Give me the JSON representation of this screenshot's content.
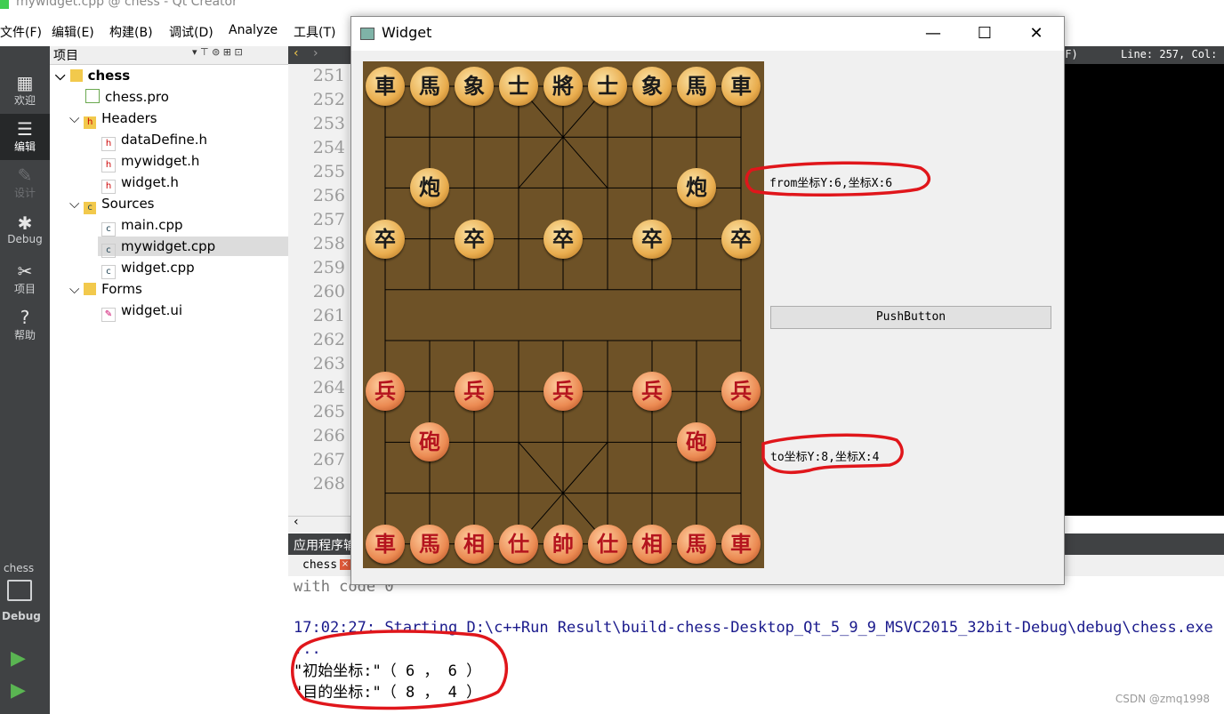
{
  "app": {
    "title": "mywidget.cpp @ chess - Qt Creator"
  },
  "menu": [
    "文件(F)",
    "编辑(E)",
    "构建(B)",
    "调试(D)",
    "Analyze",
    "工具(T)"
  ],
  "modes": [
    {
      "label": "欢迎",
      "icon": "grid-icon"
    },
    {
      "label": "编辑",
      "icon": "edit-icon"
    },
    {
      "label": "设计",
      "icon": "pencil-icon"
    },
    {
      "label": "Debug",
      "icon": "bug-icon"
    },
    {
      "label": "项目",
      "icon": "wrench-icon"
    },
    {
      "label": "帮助",
      "icon": "help-icon"
    }
  ],
  "kit": {
    "project": "chess",
    "mode": "Debug"
  },
  "project_panel": {
    "header": "项目",
    "tree": [
      {
        "label": "chess",
        "depth": 0
      },
      {
        "label": "chess.pro",
        "depth": 1
      },
      {
        "label": "Headers",
        "depth": 1
      },
      {
        "label": "dataDefine.h",
        "depth": 2
      },
      {
        "label": "mywidget.h",
        "depth": 2
      },
      {
        "label": "widget.h",
        "depth": 2
      },
      {
        "label": "Sources",
        "depth": 1
      },
      {
        "label": "main.cpp",
        "depth": 2
      },
      {
        "label": "mywidget.cpp",
        "depth": 2,
        "selected": true
      },
      {
        "label": "widget.cpp",
        "depth": 2
      },
      {
        "label": "Forms",
        "depth": 1
      },
      {
        "label": "widget.ui",
        "depth": 2
      }
    ]
  },
  "editor": {
    "status": "LF)",
    "line_col": "Line: 257, Col:",
    "line_numbers": [
      "251",
      "252",
      "253",
      "254",
      "255",
      "256",
      "257",
      "258",
      "259",
      "260",
      "261",
      "262",
      "263",
      "264",
      "265",
      "266",
      "267",
      "268"
    ]
  },
  "output": {
    "header": "应用程序输出",
    "tab": "chess",
    "lines": [
      "with code 0",
      "",
      "17:02:27: Starting D:\\c++Run Result\\build-chess-Desktop_Qt_5_9_9_MSVC2015_32bit-Debug\\debug\\chess.exe",
      "...",
      "\"初始坐标:\"（ 6 ， 6 ）",
      "\"目的坐标:\"（ 8 ， 4 ）"
    ]
  },
  "widget": {
    "title": "Widget",
    "from_label": "from坐标Y:6,坐标X:6",
    "to_label": "to坐标Y:8,坐标X:4",
    "button": "PushButton",
    "black_pieces": [
      "車",
      "馬",
      "象",
      "士",
      "將",
      "士",
      "象",
      "馬",
      "車",
      "炮",
      "炮",
      "卒",
      "卒",
      "卒",
      "卒",
      "卒"
    ],
    "red_pieces": [
      "兵",
      "兵",
      "兵",
      "兵",
      "兵",
      "砲",
      "砲",
      "車",
      "馬",
      "相",
      "仕",
      "帥",
      "仕",
      "相",
      "馬",
      "車"
    ]
  },
  "watermark": "CSDN @zmq1998",
  "colors": {
    "sidebar": "#404244",
    "board": "#6e5227",
    "output_blue": "#1a1a8c",
    "annotation_red": "#e0161b"
  }
}
